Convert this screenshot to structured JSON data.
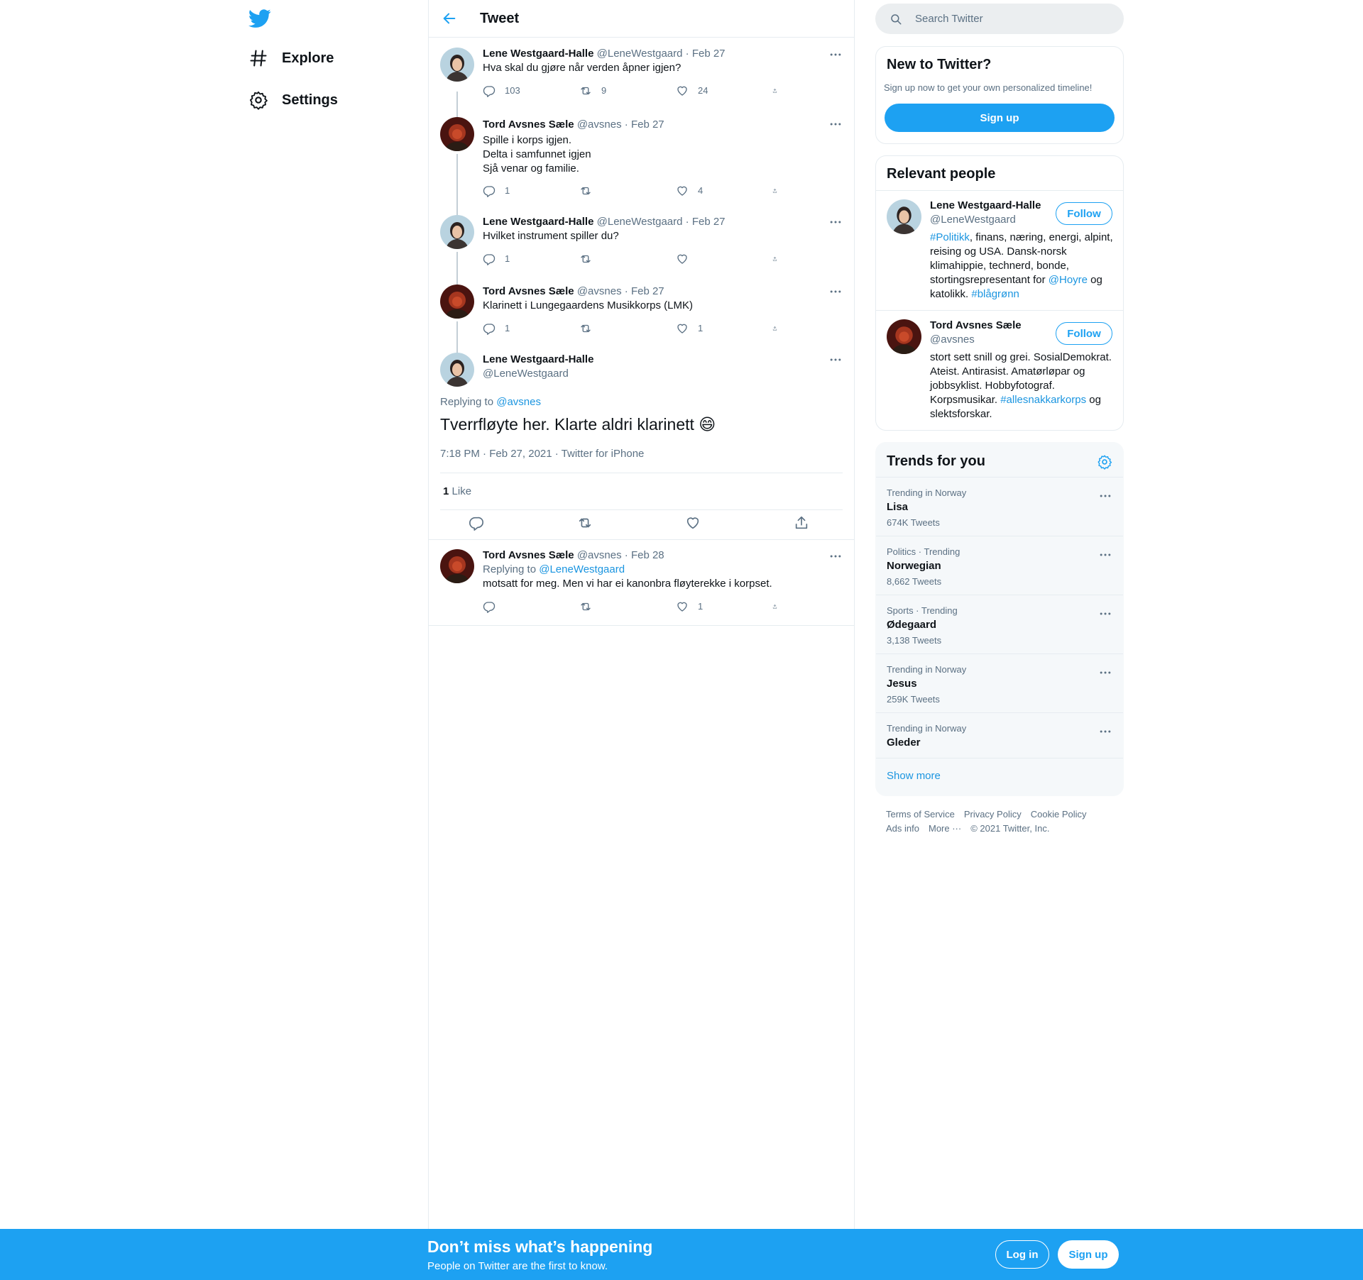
{
  "nav": {
    "logo": "twitter-bird-icon",
    "items": [
      {
        "label": "Explore",
        "icon": "hashtag-icon"
      },
      {
        "label": "Settings",
        "icon": "gear-icon"
      }
    ]
  },
  "header": {
    "title": "Tweet",
    "back_icon": "arrow-left-icon"
  },
  "thread": [
    {
      "name": "Lene Westgaard-Halle",
      "handle": "@LeneWestgaard",
      "date": "Feb 27",
      "text": "Hva skal du gjøre når verden åpner igjen?",
      "replies": "103",
      "retweets": "9",
      "likes": "24"
    },
    {
      "name": "Tord Avsnes Sæle",
      "handle": "@avsnes",
      "date": "Feb 27",
      "text": "Spille i korps igjen.\nDelta i samfunnet igjen\nSjå venar og familie.",
      "replies": "1",
      "retweets": "",
      "likes": "4"
    },
    {
      "name": "Lene Westgaard-Halle",
      "handle": "@LeneWestgaard",
      "date": "Feb 27",
      "text": "Hvilket instrument spiller du?",
      "replies": "1",
      "retweets": "",
      "likes": ""
    },
    {
      "name": "Tord Avsnes Sæle",
      "handle": "@avsnes",
      "date": "Feb 27",
      "text": "Klarinett i Lungegaardens Musikkorps (LMK)",
      "replies": "1",
      "retweets": "",
      "likes": "1"
    }
  ],
  "focus": {
    "name": "Lene Westgaard-Halle",
    "handle": "@LeneWestgaard",
    "replying_prefix": "Replying to",
    "replying_to": "@avsnes",
    "text": "Tverrfløyte her. Klarte aldri klarinett 😄",
    "timestamp": "7:18 PM · Feb 27, 2021 · Twitter for iPhone",
    "like_count": "1",
    "like_label": "Like"
  },
  "reply": {
    "name": "Tord Avsnes Sæle",
    "handle": "@avsnes",
    "date": "Feb 28",
    "replying_prefix": "Replying to",
    "replying_to": "@LeneWestgaard",
    "text": "motsatt for meg. Men vi har ei kanonbra fløyterekke i korpset.",
    "replies": "",
    "retweets": "",
    "likes": "1"
  },
  "search": {
    "placeholder": "Search Twitter"
  },
  "signup_card": {
    "title": "New to Twitter?",
    "subtitle": "Sign up now to get your own personalized timeline!",
    "button": "Sign up"
  },
  "relevant_people": {
    "title": "Relevant people",
    "follow_label": "Follow",
    "people": [
      {
        "name": "Lene Westgaard-Halle",
        "handle": "@LeneWestgaard",
        "bio": [
          "#Politikk",
          ", finans, næring, energi, alpint, reising og USA. Dansk-norsk klimahippie, technerd, bonde, stortingsrepresentant for ",
          "@Hoyre",
          " og katolikk. ",
          "#blågrønn"
        ]
      },
      {
        "name": "Tord Avsnes Sæle",
        "handle": "@avsnes",
        "bio": [
          "stort sett snill og grei. SosialDemokrat. Ateist. Antirasist. Amatørløpar og jobbsyklist. Hobbyfotograf. Korpsmusikar. ",
          "#allesnakkarkorps",
          " og slektsforskar."
        ]
      }
    ]
  },
  "trends": {
    "title": "Trends for you",
    "items": [
      {
        "context": "Trending in Norway",
        "name": "Lisa",
        "count": "674K Tweets"
      },
      {
        "context": "Politics · Trending",
        "name": "Norwegian",
        "count": "8,662 Tweets"
      },
      {
        "context": "Sports · Trending",
        "name": "Ødegaard",
        "count": "3,138 Tweets"
      },
      {
        "context": "Trending in Norway",
        "name": "Jesus",
        "count": "259K Tweets"
      },
      {
        "context": "Trending in Norway",
        "name": "Gleder",
        "count": ""
      }
    ],
    "show_more": "Show more"
  },
  "footer": {
    "links": [
      "Terms of Service",
      "Privacy Policy",
      "Cookie Policy",
      "Ads info",
      "More ···"
    ],
    "copyright": "© 2021 Twitter, Inc."
  },
  "bottom_bar": {
    "title": "Don’t miss what’s happening",
    "subtitle": "People on Twitter are the first to know.",
    "login": "Log in",
    "signup": "Sign up"
  },
  "colors": {
    "brand": "#1da1f2",
    "link": "#1b95e0",
    "muted": "#5b7083",
    "border": "#e6ecf0"
  }
}
